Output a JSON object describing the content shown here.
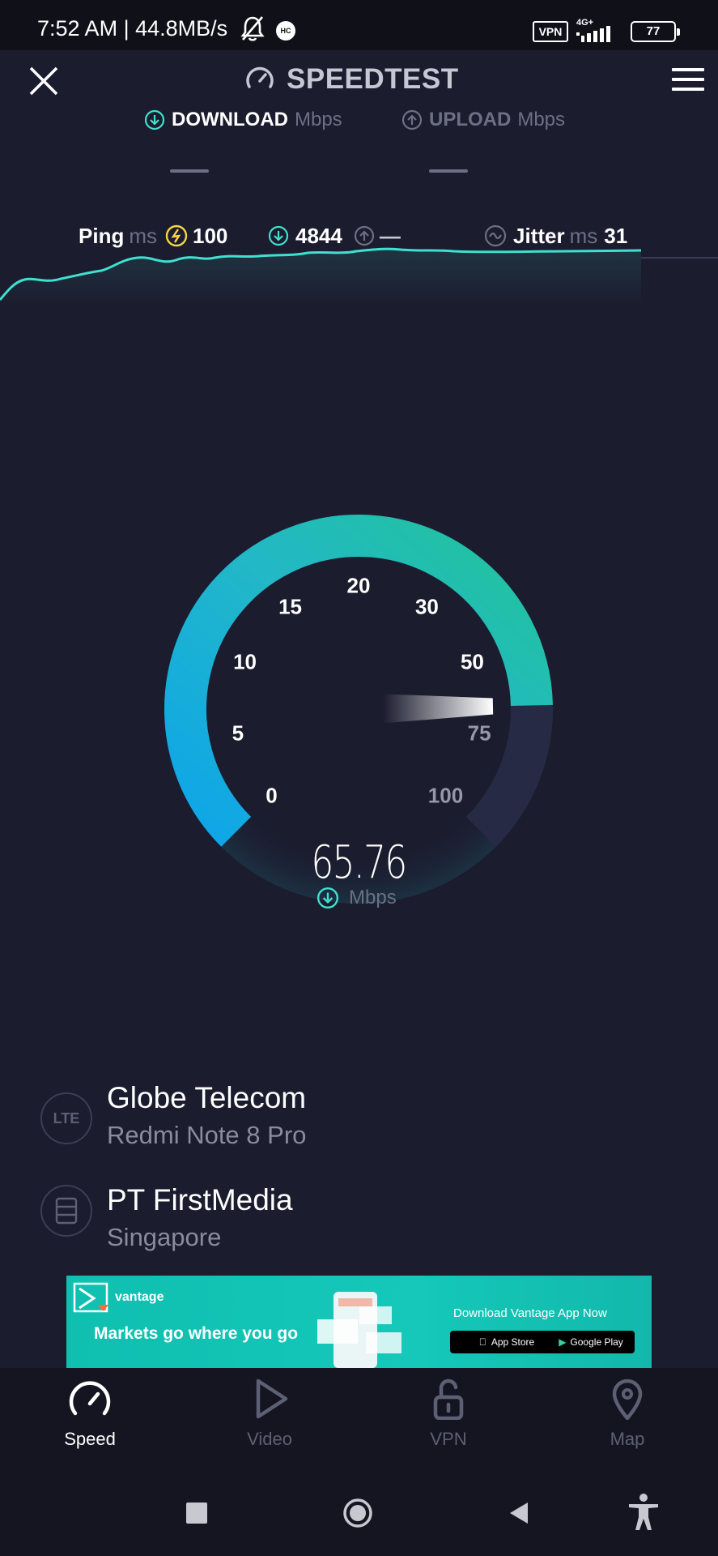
{
  "status_bar": {
    "text": "7:52 AM | 44.8MB/s",
    "hc_badge": "HC",
    "vpn_badge": "VPN",
    "network_type": "4G+",
    "battery": "77"
  },
  "header": {
    "title": "SPEEDTEST",
    "close_icon": "close-icon",
    "menu_icon": "hamburger-menu-icon"
  },
  "download": {
    "label": "DOWNLOAD",
    "unit": "Mbps",
    "value": "—"
  },
  "upload": {
    "label": "UPLOAD",
    "unit": "Mbps",
    "value": "—"
  },
  "metrics": {
    "ping_label": "Ping",
    "ping_unit": "ms",
    "ping_value": "100",
    "download_ping": "4844",
    "upload_ping": "—",
    "jitter_label": "Jitter",
    "jitter_unit": "ms",
    "jitter_value": "31"
  },
  "gauge": {
    "ticks": [
      "0",
      "5",
      "10",
      "15",
      "20",
      "30",
      "50",
      "75",
      "100"
    ],
    "current_value": 65.76,
    "value_text": "65.76",
    "unit": "Mbps",
    "colors": {
      "start": "#0ea5e9",
      "mid": "#22b8c7",
      "end": "#22c39a",
      "remaining": "#262a45"
    }
  },
  "isp": {
    "icon": "lte-icon",
    "icon_text": "LTE",
    "name": "Globe Telecom",
    "device": "Redmi Note 8 Pro"
  },
  "server": {
    "icon": "server-icon",
    "name": "PT FirstMedia",
    "location": "Singapore"
  },
  "ad": {
    "brand": "vantage",
    "tagline": "Markets go where you go",
    "cta": "Download Vantage App Now",
    "app_store": "App Store",
    "google_play": "Google Play"
  },
  "nav": {
    "items": [
      {
        "label": "Speed",
        "icon": "speed-icon",
        "active": true
      },
      {
        "label": "Video",
        "icon": "play-icon",
        "active": false
      },
      {
        "label": "VPN",
        "icon": "unlock-icon",
        "active": false
      },
      {
        "label": "Map",
        "icon": "map-pin-icon",
        "active": false
      }
    ]
  },
  "system_nav": [
    "recents-button",
    "home-button",
    "back-button",
    "accessibility-button"
  ],
  "colors": {
    "background": "#1b1c2e",
    "accent": "#3fe0d0",
    "ping_yellow": "#f5d547"
  }
}
